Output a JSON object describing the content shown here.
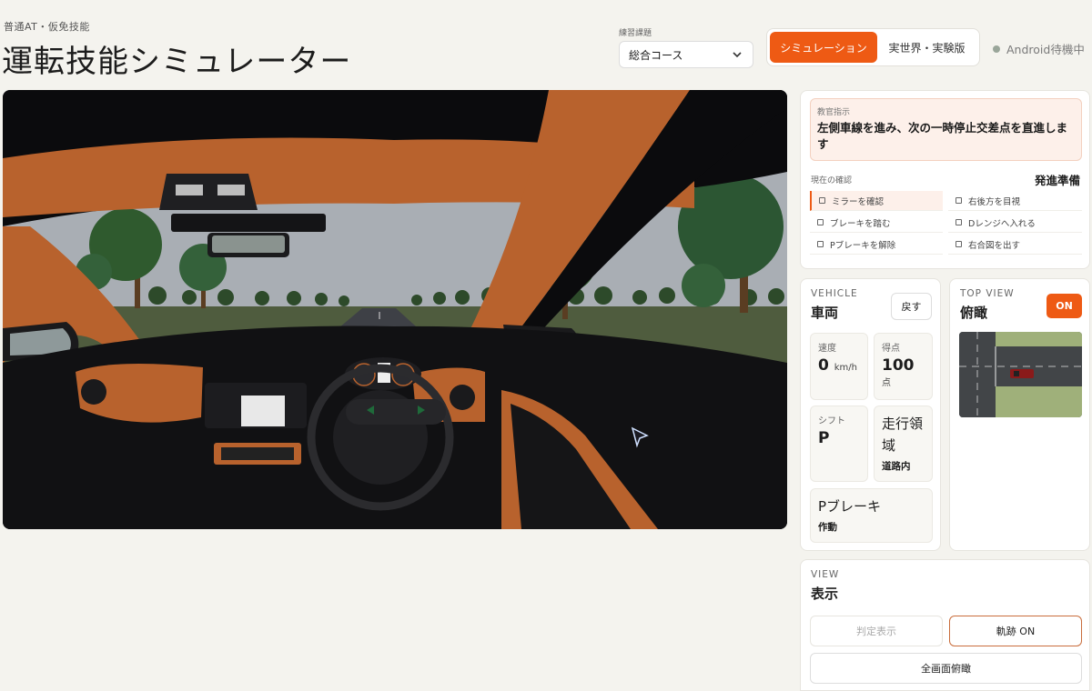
{
  "header": {
    "subtitle": "普通AT・仮免技能",
    "title": "運転技能シミュレーター"
  },
  "course": {
    "label": "練習課題",
    "selected": "総合コース"
  },
  "mode": {
    "simulation": "シミュレーション",
    "real": "実世界・実験版"
  },
  "status": {
    "text": "Android待機中",
    "color": "#9aa69a"
  },
  "instruction": {
    "tag": "教官指示",
    "text": "左側車線を進み、次の一時停止交差点を直進します"
  },
  "checklist": {
    "label": "現在の確認",
    "stage": "発進準備",
    "items": [
      {
        "label": "ミラーを確認",
        "current": true
      },
      {
        "label": "右後方を目視",
        "current": false
      },
      {
        "label": "ブレーキを踏む",
        "current": false
      },
      {
        "label": "Dレンジへ入れる",
        "current": false
      },
      {
        "label": "Pブレーキを解除",
        "current": false
      },
      {
        "label": "右合図を出す",
        "current": false
      }
    ]
  },
  "vehicle": {
    "tag": "VEHICLE",
    "title": "車両",
    "back": "戻す",
    "speed_label": "速度",
    "speed_value": "0",
    "speed_unit": "km/h",
    "score_label": "得点",
    "score_value": "100",
    "score_unit": "点",
    "shift_label": "シフト",
    "shift_value": "P",
    "area_label": "走行領域",
    "area_value": "道路内",
    "pbrake_label": "Pブレーキ",
    "pbrake_value": "作動"
  },
  "topview": {
    "tag": "TOP VIEW",
    "title": "俯瞰",
    "state": "ON"
  },
  "view": {
    "tag": "VIEW",
    "title": "表示",
    "judge": "判定表示",
    "trail": "軌跡 ON",
    "fullscreen": "全画面俯瞰"
  },
  "colors": {
    "accent": "#ee5a14",
    "interior": "#b8622d"
  }
}
